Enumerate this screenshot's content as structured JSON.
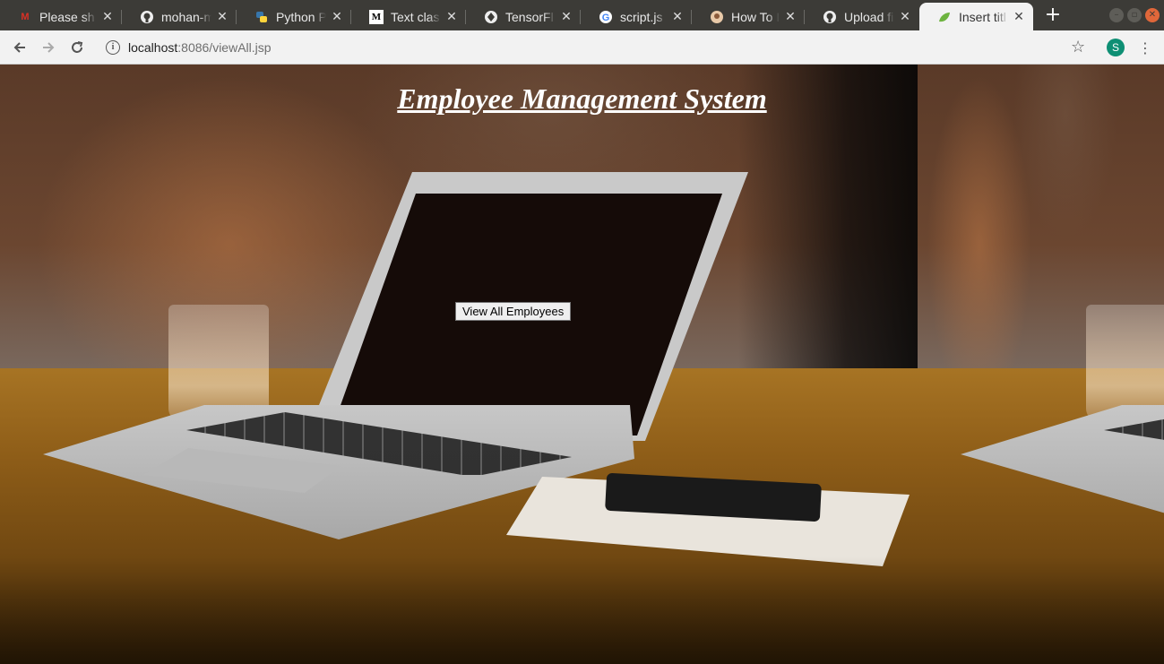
{
  "browser": {
    "tabs": [
      {
        "title": "Please sh",
        "icon": "gmail-icon",
        "active": false
      },
      {
        "title": "mohan-m",
        "icon": "github-icon",
        "active": false
      },
      {
        "title": "Python P",
        "icon": "python-icon",
        "active": false
      },
      {
        "title": "Text clas",
        "icon": "medium-icon",
        "active": false
      },
      {
        "title": "TensorFl",
        "icon": "tensorflow-icon",
        "active": false
      },
      {
        "title": "script.js",
        "icon": "google-icon",
        "active": false
      },
      {
        "title": "How To I",
        "icon": "avatar-icon",
        "active": false
      },
      {
        "title": "Upload fi",
        "icon": "github-icon",
        "active": false
      },
      {
        "title": "Insert titl",
        "icon": "leaf-icon",
        "active": true
      }
    ],
    "url_host": "localhost",
    "url_path": ":8086/viewAll.jsp",
    "profile_initial": "S"
  },
  "page": {
    "heading": "Employee Management System",
    "view_button_label": "View All Employees"
  },
  "colors": {
    "tabstrip": "#3c3b37",
    "toolbar": "#f2f2f2",
    "profile": "#0e8f74",
    "heading": "#ffffff"
  }
}
